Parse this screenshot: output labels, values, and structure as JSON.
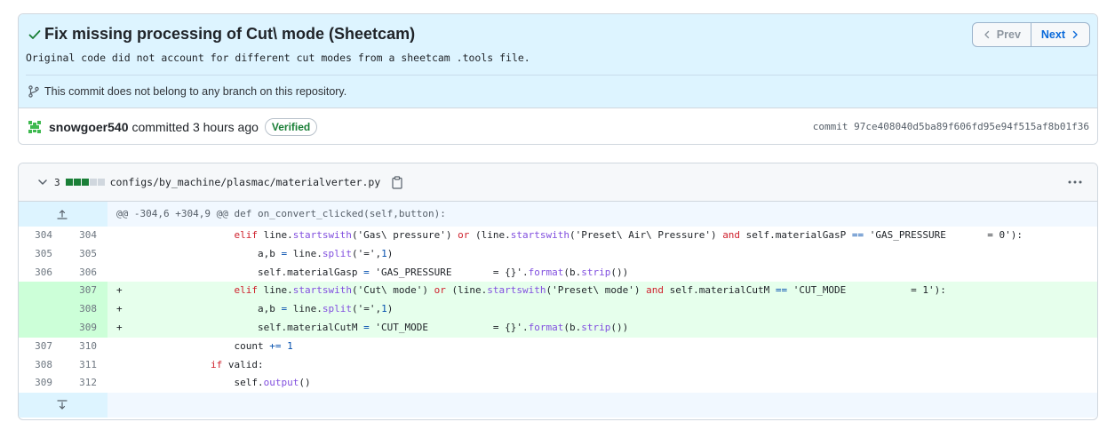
{
  "commit": {
    "title": "Fix missing processing of Cut\\ mode (Sheetcam)",
    "description": "Original code did not account for different cut modes from a sheetcam .tools file.",
    "branch_notice": "This commit does not belong to any branch on this repository.",
    "author": "snowgoer540",
    "meta": "committed 3 hours ago",
    "verified_label": "Verified",
    "sha_label": "commit 97ce408040d5ba89f606fd95e94f515af8b01f36",
    "prev_label": "Prev",
    "next_label": "Next"
  },
  "file": {
    "change_count": "3",
    "path": "configs/by_machine/plasmac/materialverter.py",
    "hunk_header": "@@ -304,6 +304,9 @@ def on_convert_clicked(self,button):"
  },
  "colors": {
    "accent": "#0969da",
    "added_bg": "#e6ffec",
    "added_gutter": "#ccffd8",
    "verified": "#1a7f37",
    "header_bg": "#ddf4ff"
  },
  "lines": [
    {
      "old": "304",
      "new": "304",
      "type": "ctx",
      "indent": "                    ",
      "tokens": [
        [
          "kw",
          "elif"
        ],
        [
          "",
          "  line."
        ],
        [
          "fn",
          "startswith"
        ],
        [
          "",
          "("
        ],
        [
          "str",
          "'Gas\\ pressure'"
        ],
        [
          "",
          ") "
        ],
        [
          "kw",
          "or"
        ],
        [
          "",
          ""
        ],
        [
          "",
          ""
        ],
        [
          "",
          ""
        ],
        [
          "",
          ""
        ],
        [
          "",
          ""
        ],
        [
          "",
          ""
        ],
        [
          "",
          ""
        ],
        [
          "",
          ""
        ]
      ]
    },
    {
      "old": "305",
      "new": "305",
      "type": "ctx"
    },
    {
      "old": "306",
      "new": "306",
      "type": "ctx"
    },
    {
      "old": "",
      "new": "307",
      "type": "add",
      "marker": "+"
    },
    {
      "old": "",
      "new": "308",
      "type": "add",
      "marker": "+"
    },
    {
      "old": "",
      "new": "309",
      "type": "add",
      "marker": "+"
    },
    {
      "old": "307",
      "new": "310",
      "type": "ctx"
    },
    {
      "old": "308",
      "new": "311",
      "type": "ctx"
    },
    {
      "old": "309",
      "new": "312",
      "type": "ctx"
    }
  ],
  "code": {
    "l1_a": "elif",
    "l1_b": " line.",
    "l1_c": "startswith",
    "l1_d": "('Gas\\ pressure') ",
    "l1_e": "or",
    "l1_f": " (line.",
    "l1_g": "startswith",
    "l1_h": "('Preset\\ Air\\ Pressure') ",
    "l1_i": "and",
    "l1_j": " self.materialGasP ",
    "l1_k": "==",
    "l1_l": " 'GAS_PRESSURE       = 0'):",
    "l2_a": "a,b ",
    "l2_b": "=",
    "l2_c": " line.",
    "l2_d": "split",
    "l2_e": "('=',",
    "l2_f": "1",
    "l2_g": ")",
    "l3_a": "self.materialGasp ",
    "l3_b": "=",
    "l3_c": " 'GAS_PRESSURE       = {}'.",
    "l3_d": "format",
    "l3_e": "(b.",
    "l3_f": "strip",
    "l3_g": "())",
    "l4_a": "elif",
    "l4_b": " line.",
    "l4_c": "startswith",
    "l4_d": "('Cut\\ mode') ",
    "l4_e": "or",
    "l4_f": " (line.",
    "l4_g": "startswith",
    "l4_h": "('Preset\\ mode') ",
    "l4_i": "and",
    "l4_j": " self.materialCutM ",
    "l4_k": "==",
    "l4_l": " 'CUT_MODE           = 1'):",
    "l5_a": "a,b ",
    "l5_b": "=",
    "l5_c": " line.",
    "l5_d": "split",
    "l5_e": "('=',",
    "l5_f": "1",
    "l5_g": ")",
    "l6_a": "self.materialCutM ",
    "l6_b": "=",
    "l6_c": " 'CUT_MODE           = {}'.",
    "l6_d": "format",
    "l6_e": "(b.",
    "l6_f": "strip",
    "l6_g": "())",
    "l7_a": "count ",
    "l7_b": "+=",
    "l7_c": " ",
    "l7_d": "1",
    "l8_a": "if",
    "l8_b": " valid:",
    "l9_a": "self.",
    "l9_b": "output",
    "l9_c": "()"
  }
}
